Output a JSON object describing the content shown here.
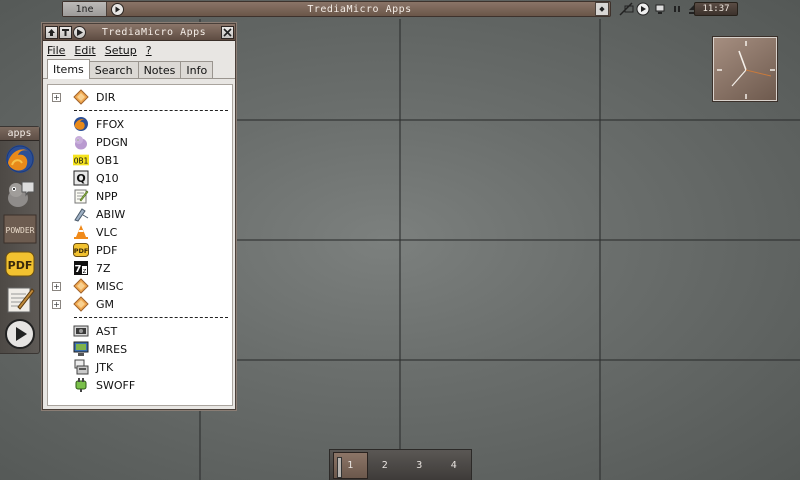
{
  "top_panel": {
    "task_name": "1ne",
    "task_title": "TrediaMicro Apps",
    "clock_text": "11:37"
  },
  "side_launcher": {
    "label": "apps",
    "apps": [
      {
        "name": "firefox-launcher"
      },
      {
        "name": "pidgin-launcher"
      },
      {
        "name": "powder-launcher",
        "text": "POWDER"
      },
      {
        "name": "pdf-launcher",
        "text": "PDF"
      },
      {
        "name": "editor-launcher"
      },
      {
        "name": "play-launcher"
      }
    ]
  },
  "window": {
    "title": "TrediaMicro Apps",
    "menu": {
      "file": "File",
      "edit": "Edit",
      "setup": "Setup",
      "help": "?"
    },
    "tabs": {
      "items": "Items",
      "search": "Search",
      "notes": "Notes",
      "info": "Info"
    },
    "items": [
      {
        "label": "DIR",
        "expandable": true,
        "icon": "folder-diamond-icon"
      },
      {
        "label": "FFOX",
        "icon": "firefox-icon"
      },
      {
        "label": "PDGN",
        "icon": "pidgin-icon"
      },
      {
        "label": "OB1",
        "icon": "ob1-icon",
        "icon_text": "OB1"
      },
      {
        "label": "Q10",
        "icon": "q10-icon"
      },
      {
        "label": "NPP",
        "icon": "notepad-icon"
      },
      {
        "label": "ABIW",
        "icon": "abiword-icon"
      },
      {
        "label": "VLC",
        "icon": "vlc-cone-icon"
      },
      {
        "label": "PDF",
        "icon": "pdf-icon",
        "icon_text": "PDF"
      },
      {
        "label": "7Z",
        "icon": "7zip-icon"
      },
      {
        "label": "MISC",
        "expandable": true,
        "icon": "folder-diamond-icon"
      },
      {
        "label": "GM",
        "expandable": true,
        "icon": "folder-diamond-icon"
      },
      {
        "label": "AST",
        "icon": "ast-icon"
      },
      {
        "label": "MRES",
        "icon": "monitor-resolution-icon"
      },
      {
        "label": "JTK",
        "icon": "jtk-icon"
      },
      {
        "label": "SWOFF",
        "icon": "power-plug-icon"
      }
    ]
  },
  "pager": {
    "desktops": [
      "1",
      "2",
      "3",
      "4"
    ],
    "active": "1"
  },
  "colors": {
    "panel_brown": "#7a665b",
    "desktop_gray": "#6a6e6c",
    "list_bg": "#ffffff"
  }
}
